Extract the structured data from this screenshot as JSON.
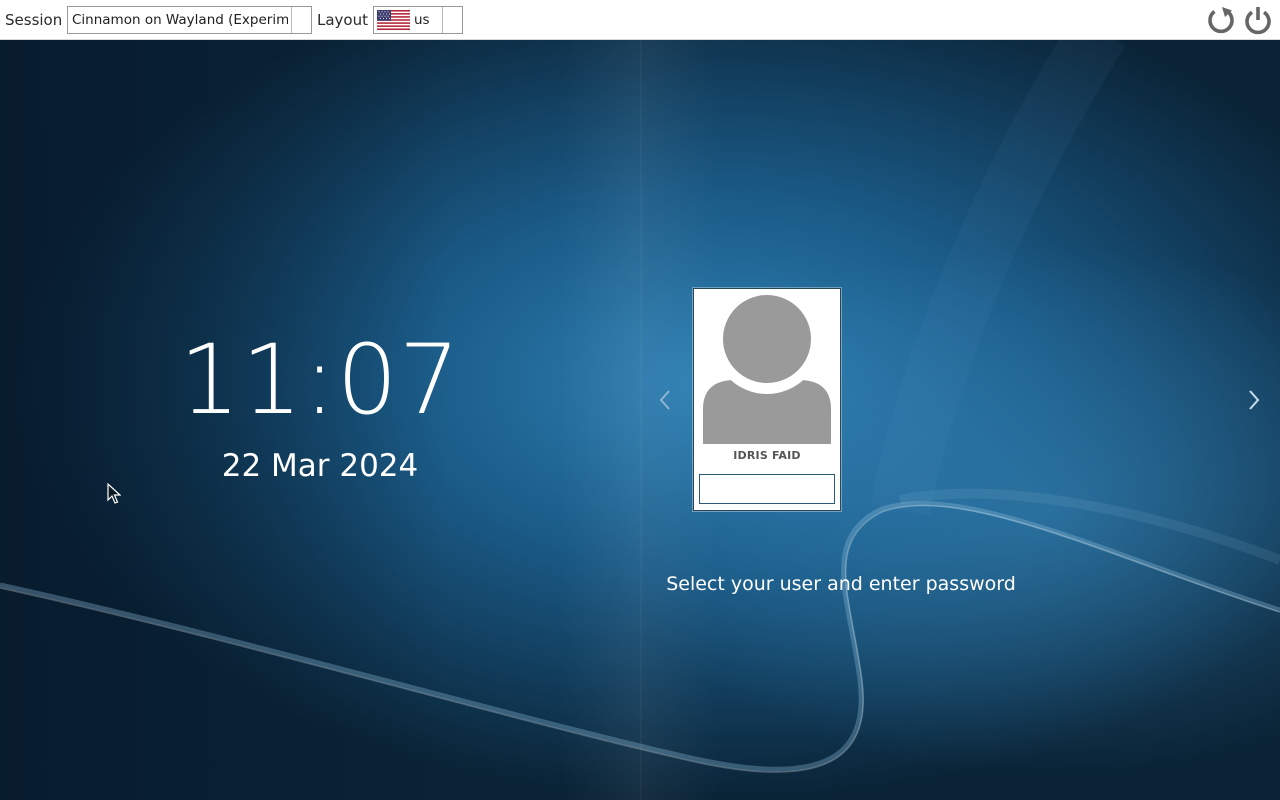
{
  "topbar": {
    "session_label": "Session",
    "session_value": "Cinnamon on Wayland (Experime",
    "layout_label": "Layout",
    "layout_value": "us",
    "layout_flag_icon": "us-flag-icon",
    "restart_icon": "restart-icon",
    "power_icon": "power-icon"
  },
  "clock": {
    "time": "11:07",
    "date": "22 Mar 2024"
  },
  "user": {
    "name": "IDRIS FAID",
    "password_value": "",
    "avatar_icon": "user-avatar-icon"
  },
  "prompt": "Select your user and enter password",
  "nav": {
    "prev_icon": "chevron-left-icon",
    "next_icon": "chevron-right-icon"
  },
  "colors": {
    "background_dark": "#0a2438",
    "background_light": "#2a7ab0",
    "accent_swoosh": "#6fa8cf",
    "card_border": "#2b4656",
    "avatar_gray": "#9a9a9a"
  }
}
